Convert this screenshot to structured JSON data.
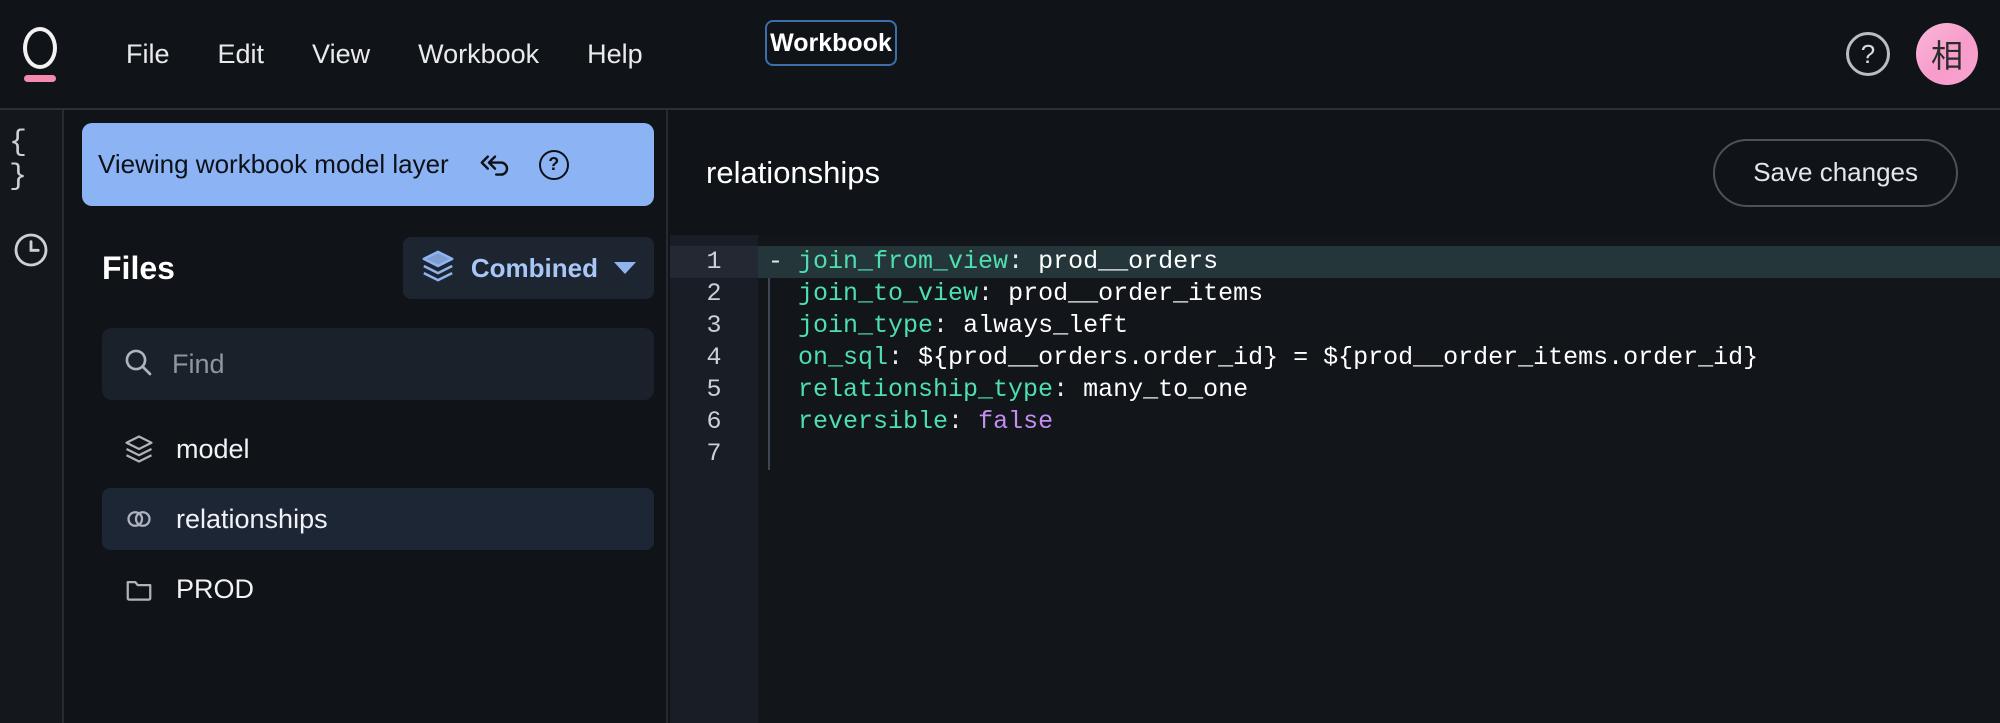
{
  "app": {
    "logo_icon": "omni-ring-logo",
    "menu": [
      {
        "label": "File"
      },
      {
        "label": "Edit"
      },
      {
        "label": "View"
      },
      {
        "label": "Workbook"
      },
      {
        "label": "Help"
      }
    ],
    "mode_pill_label": "Workbook",
    "help_icon_glyph": "?",
    "avatar_initial": "相"
  },
  "rail": {
    "items": [
      {
        "icon": "code-braces-icon",
        "glyph": "{ }"
      },
      {
        "icon": "clock-history-icon",
        "glyph": "clock"
      }
    ]
  },
  "left_panel": {
    "banner": {
      "text": "Viewing workbook model layer",
      "revert_icon": "undo-double-arrow-icon",
      "help_icon": "question-mark-icon",
      "background_color": "#8cb4f5"
    },
    "files_title": "Files",
    "branch_selector": {
      "label": "Combined",
      "icon": "layers-icon",
      "caret": "chevron-down-icon"
    },
    "search": {
      "placeholder": "Find",
      "value": "",
      "icon": "search-icon"
    },
    "files": [
      {
        "label": "model",
        "icon": "layers-icon",
        "selected": false
      },
      {
        "label": "relationships",
        "icon": "link-rings-icon",
        "selected": true
      },
      {
        "label": "PROD",
        "icon": "folder-icon",
        "selected": false
      }
    ]
  },
  "editor": {
    "title": "relationships",
    "save_label": "Save changes",
    "active_line": 1,
    "lines": [
      {
        "n": "1",
        "tokens": [
          {
            "t": "- ",
            "c": "p"
          },
          {
            "t": "join_from_view",
            "c": "k"
          },
          {
            "t": ": ",
            "c": "p"
          },
          {
            "t": "prod__orders",
            "c": "v"
          }
        ]
      },
      {
        "n": "2",
        "tokens": [
          {
            "t": "  ",
            "c": "p"
          },
          {
            "t": "join_to_view",
            "c": "k"
          },
          {
            "t": ": ",
            "c": "p"
          },
          {
            "t": "prod__order_items",
            "c": "v"
          }
        ]
      },
      {
        "n": "3",
        "tokens": [
          {
            "t": "  ",
            "c": "p"
          },
          {
            "t": "join_type",
            "c": "k"
          },
          {
            "t": ": ",
            "c": "p"
          },
          {
            "t": "always_left",
            "c": "v"
          }
        ]
      },
      {
        "n": "4",
        "tokens": [
          {
            "t": "  ",
            "c": "p"
          },
          {
            "t": "on_sql",
            "c": "k"
          },
          {
            "t": ": ",
            "c": "p"
          },
          {
            "t": "${prod__orders.order_id} = ${prod__order_items.order_id}",
            "c": "v"
          }
        ]
      },
      {
        "n": "5",
        "tokens": [
          {
            "t": "  ",
            "c": "p"
          },
          {
            "t": "relationship_type",
            "c": "k"
          },
          {
            "t": ": ",
            "c": "p"
          },
          {
            "t": "many_to_one",
            "c": "v"
          }
        ]
      },
      {
        "n": "6",
        "tokens": [
          {
            "t": "  ",
            "c": "p"
          },
          {
            "t": "reversible",
            "c": "k"
          },
          {
            "t": ": ",
            "c": "p"
          },
          {
            "t": "false",
            "c": "b"
          }
        ]
      },
      {
        "n": "7",
        "tokens": []
      }
    ]
  },
  "colors": {
    "accent_pink": "#f58ab0",
    "banner_blue": "#8cb4f5",
    "selection_blue": "#1d2635",
    "yaml_key": "#4ddfae",
    "yaml_bool": "#c58df0",
    "background": "#101317"
  }
}
